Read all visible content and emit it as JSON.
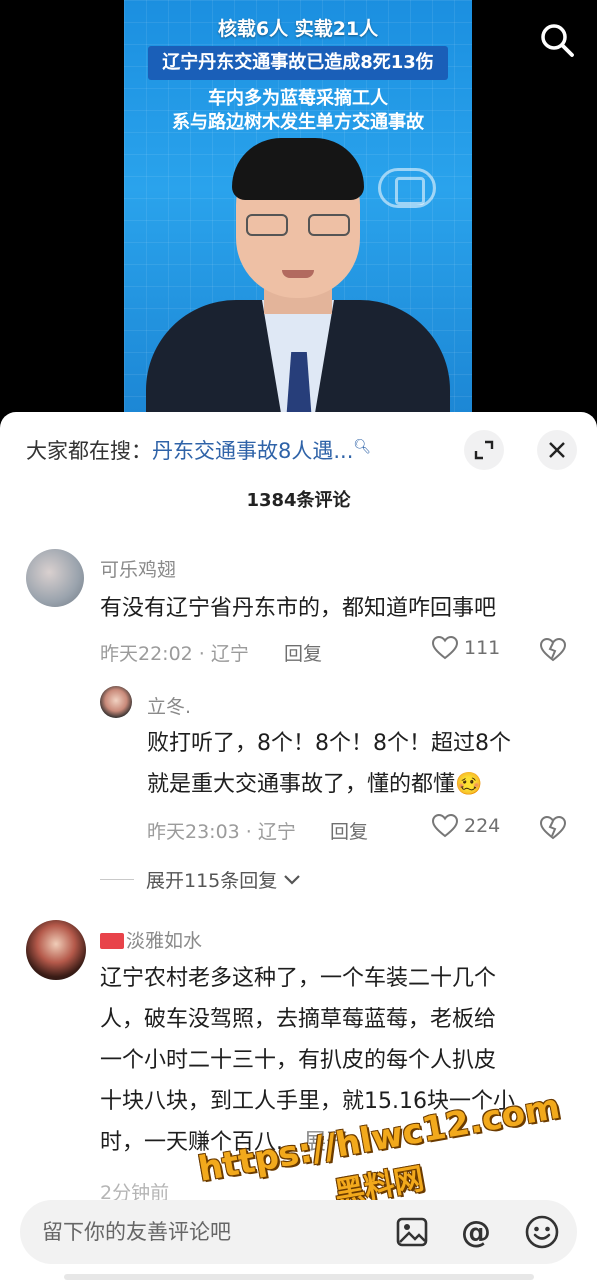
{
  "video": {
    "headline1": "核载6人 实载21人",
    "headline2": "辽宁丹东交通事故已造成8死13伤",
    "headline3": "车内多为蓝莓采摘工人",
    "headline4": "系与路边树木发生单方交通事故"
  },
  "sheet": {
    "hot_search_label": "大家都在搜：",
    "hot_search_keyword": "丹东交通事故8人遇...",
    "comment_count_title": "1384条评论"
  },
  "comments": [
    {
      "username": "可乐鸡翅",
      "text": "有没有辽宁省丹东市的，都知道咋回事吧",
      "time_location": "昨天22:02 · 辽宁",
      "reply_label": "回复",
      "likes": "111"
    },
    {
      "username": "淡雅如水",
      "text_lines": [
        "辽宁农村老多这种了，一个车装二十几个",
        "人，破车没驾照，去摘草莓蓝莓，老板给",
        "一个小时二十三十，有扒皮的每个人扒皮",
        "十块八块，到工人手里，就15.16块一个小",
        "时，一天赚个百八..."
      ],
      "more_label": "展开",
      "time_location": "2分钟前"
    }
  ],
  "reply": {
    "username": "立冬.",
    "text_line1": "败打听了，8个！8个！8个！超过8个",
    "text_line2": "就是重大交通事故了，懂的都懂",
    "emoji": "🥴",
    "time_location": "昨天23:03 · 辽宁",
    "reply_label": "回复",
    "likes": "224"
  },
  "expand_replies_label": "展开115条回复",
  "watermark": {
    "line1": "https://hlwc12.com",
    "line2": "黑料网"
  },
  "input": {
    "placeholder": "留下你的友善评论吧"
  }
}
